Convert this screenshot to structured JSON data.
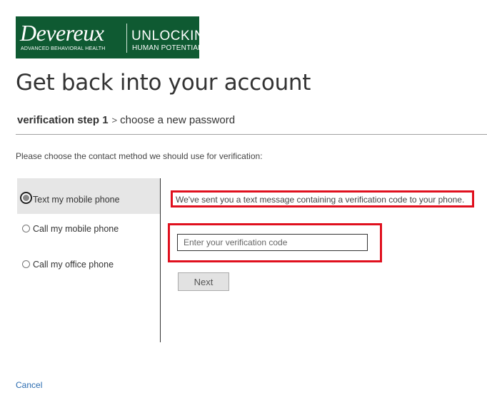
{
  "logo": {
    "brand": "Devereux",
    "subtitle": "ADVANCED BEHAVIORAL HEALTH",
    "tagline_line1": "UNLOCKING",
    "tagline_line2": "HUMAN POTENTIAL™",
    "color": "#0f5a32"
  },
  "page_title": "Get back into your account",
  "steps": {
    "active": "verification step 1",
    "separator": ">",
    "next": "choose a new password"
  },
  "instruction": "Please choose the contact method we should use for verification:",
  "options": [
    {
      "label": "Text my mobile phone",
      "selected": true
    },
    {
      "label": "Call my mobile phone",
      "selected": false
    },
    {
      "label": "Call my office phone",
      "selected": false
    }
  ],
  "message": "We've sent you a text message containing a verification code to your phone.",
  "code_input": {
    "placeholder": "Enter your verification code",
    "value": ""
  },
  "next_button": "Next",
  "cancel_link": "Cancel",
  "colors": {
    "highlight": "#e0101e",
    "link": "#2a6bb0"
  }
}
